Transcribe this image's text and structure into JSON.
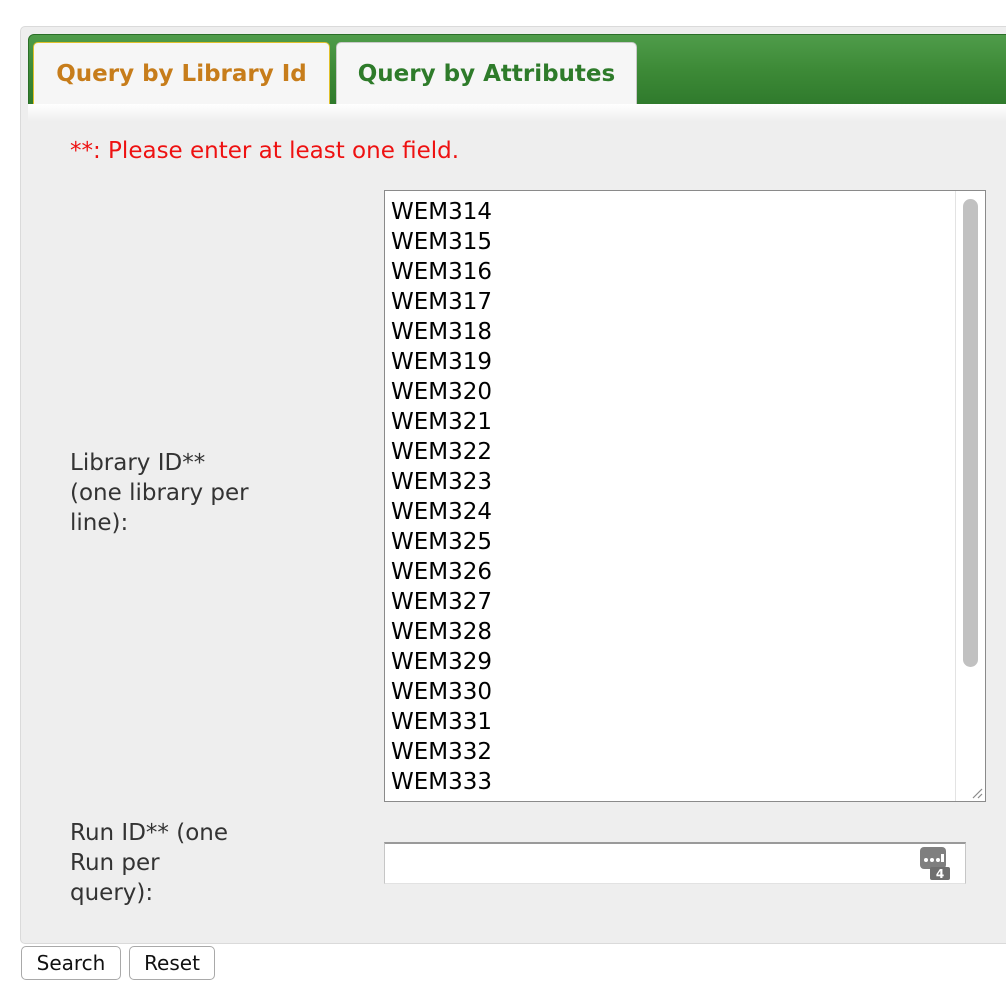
{
  "tabs": [
    {
      "label": "Query by Library Id",
      "active": true,
      "color": "#c77d1b"
    },
    {
      "label": "Query by Attributes",
      "active": false,
      "color": "#2e7b2a"
    }
  ],
  "form": {
    "required_note": "**: Please enter at least one field.",
    "library_label": "Library ID** (one library per line):",
    "library_ids": [
      "WEM314",
      "WEM315",
      "WEM316",
      "WEM317",
      "WEM318",
      "WEM319",
      "WEM320",
      "WEM321",
      "WEM322",
      "WEM323",
      "WEM324",
      "WEM325",
      "WEM326",
      "WEM327",
      "WEM328",
      "WEM329",
      "WEM330",
      "WEM331",
      "WEM332",
      "WEM333"
    ],
    "run_label": "Run ID** (one Run per query):",
    "run_value": "",
    "keypad_badge": "4"
  },
  "buttons": {
    "search": "Search",
    "reset": "Reset"
  },
  "colors": {
    "tab_bar": "#3d8a37",
    "required": "#ee1111",
    "panel": "#eeeeee"
  }
}
